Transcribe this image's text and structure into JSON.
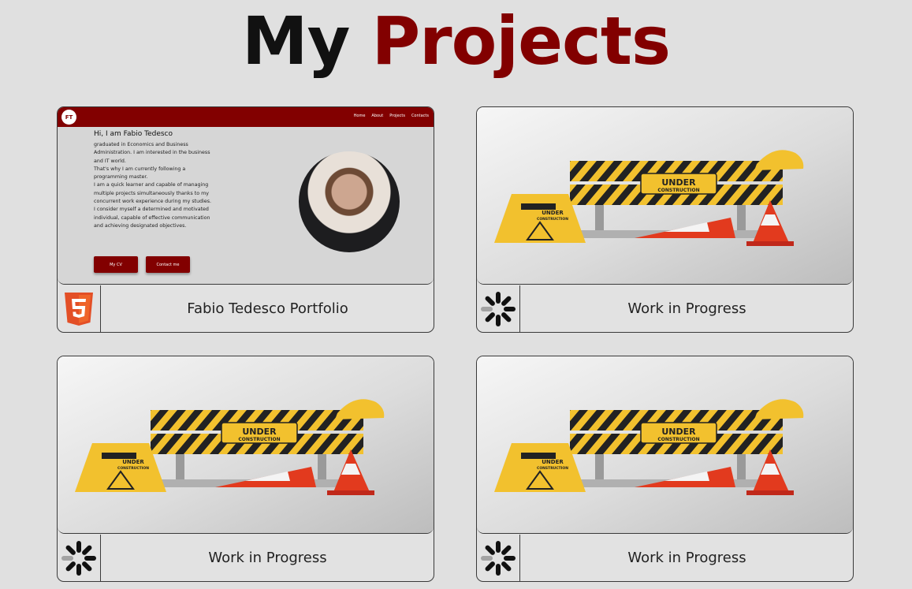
{
  "page_title": {
    "word1": "My",
    "word2": "Projects"
  },
  "projects": [
    {
      "title": "Fabio Tedesco Portfolio",
      "icon": "html5-icon",
      "preview": {
        "logo": "FT",
        "nav_links": [
          "Home",
          "About",
          "Projects",
          "Contacts"
        ],
        "heading": "Hi, I am Fabio Tedesco",
        "bio": "graduated in Economics and Business\nAdministration. I am interested in the business\nand IT world.\nThat's why I am currently following a\nprogramming master.\nI am a quick learner and capable of managing\nmultiple projects simultaneously thanks to my\nconcurrent work experience during my studies.\nI consider myself a determined and motivated\nindividual, capable of effective communication\nand achieving designated objectives.",
        "btn_cv": "My CV",
        "btn_contact": "Contact me"
      }
    },
    {
      "title": "Work in Progress",
      "icon": "loading-spinner-icon",
      "sign_label": "UNDER",
      "sign_sub": "CONSTRUCTION"
    },
    {
      "title": "Work in Progress",
      "icon": "loading-spinner-icon",
      "sign_label": "UNDER",
      "sign_sub": "CONSTRUCTION"
    },
    {
      "title": "Work in Progress",
      "icon": "loading-spinner-icon",
      "sign_label": "UNDER",
      "sign_sub": "CONSTRUCTION"
    }
  ],
  "colors": {
    "accent": "#820000",
    "background": "#e0e0e0"
  }
}
